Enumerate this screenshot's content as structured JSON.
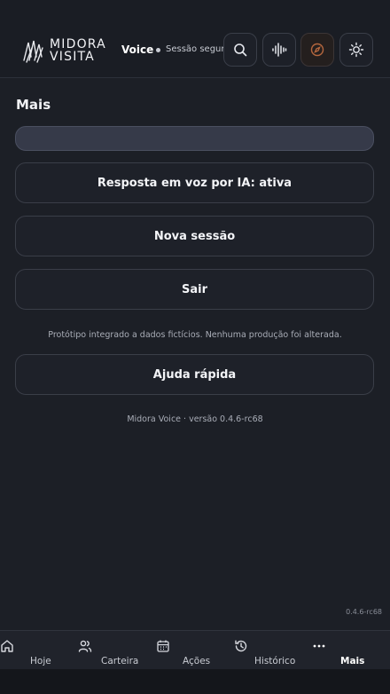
{
  "header": {
    "logo_line1": "MIDORA",
    "logo_line2": "VISITA",
    "mode_label": "Voice",
    "secure_label": "Sessão segura",
    "buttons": [
      {
        "icon": "search-icon"
      },
      {
        "icon": "waveform-icon"
      },
      {
        "icon": "compass-icon"
      },
      {
        "icon": "sun-icon"
      }
    ]
  },
  "main": {
    "title": "Mais",
    "voice_toggle_label": "Resposta em voz por IA: ativa",
    "new_session_label": "Nova sessão",
    "logout_label": "Sair",
    "prototype_note": "Protótipo integrado a dados fictícios. Nenhuma produção foi alterada.",
    "help_label": "Ajuda rápida",
    "version_text": "Midora Voice · versão 0.4.6-rc68",
    "build_tag": "0.4.6-rc68"
  },
  "nav": {
    "items": [
      {
        "label": "Hoje",
        "icon": "home-icon"
      },
      {
        "label": "Carteira",
        "icon": "users-icon"
      },
      {
        "label": "Ações",
        "icon": "calendar-icon"
      },
      {
        "label": "Histórico",
        "icon": "history-icon"
      },
      {
        "label": "Mais",
        "icon": "more-icon",
        "active": true
      }
    ]
  },
  "colors": {
    "background": "#1c1f26",
    "card": "#1e2129",
    "search_bar": "#363a49",
    "accent_icon": "#b5673e"
  }
}
